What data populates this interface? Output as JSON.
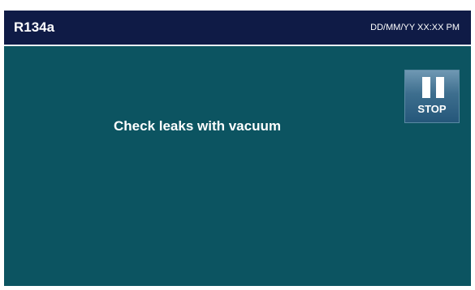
{
  "header": {
    "title": "R134a",
    "datetime": "DD/MM/YY XX:XX PM"
  },
  "main": {
    "message": "Check leaks with vacuum"
  },
  "controls": {
    "stop_label": "STOP",
    "stop_icon": "pause-icon"
  },
  "colors": {
    "header_bg": "#0f1b46",
    "panel_bg": "#0c5461",
    "button_bg": "#3d6e8e",
    "text": "#ffffff"
  }
}
